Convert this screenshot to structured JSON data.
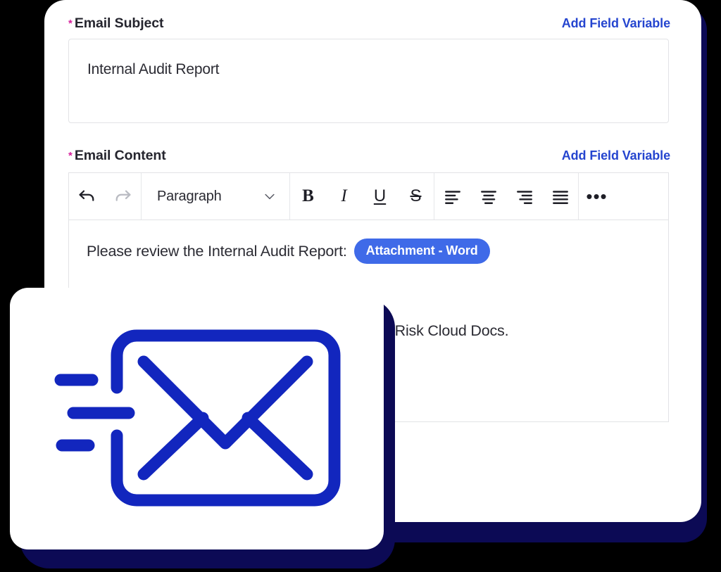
{
  "theme": {
    "accent_link": "#2545CF",
    "required_star": "#D6219C",
    "chip_bg": "#3F6AE8",
    "card_shadow_navy": "#0C0A55",
    "icon_blue": "#1226BE",
    "text_dark": "#2B2B33",
    "border_gray": "#E2E3E6",
    "disabled_gray": "#B9BBC2"
  },
  "subject_field": {
    "label": "Email Subject",
    "required_marker": "*",
    "add_variable_label": "Add Field Variable",
    "value": "Internal Audit Report",
    "placeholder": ""
  },
  "content_field": {
    "label": "Email Content",
    "required_marker": "*",
    "add_variable_label": "Add Field Variable"
  },
  "toolbar": {
    "undo": {
      "icon": "undo-arrow-icon",
      "glyph": "↶",
      "state": "enabled"
    },
    "redo": {
      "icon": "redo-arrow-icon",
      "glyph": "↷",
      "state": "disabled"
    },
    "block_format": {
      "selected": "Paragraph",
      "chevron_icon": "chevron-down-icon",
      "options": [
        "Paragraph"
      ]
    },
    "bold": {
      "label": "B",
      "name": "bold-button"
    },
    "italic": {
      "label": "I",
      "name": "italic-button"
    },
    "underline": {
      "label": "U",
      "name": "underline-button"
    },
    "strikethrough": {
      "label": "S",
      "name": "strikethrough-button"
    },
    "align_left": {
      "icon": "align-left-icon"
    },
    "align_center": {
      "icon": "align-center-icon"
    },
    "align_right": {
      "icon": "align-right-icon"
    },
    "align_justify": {
      "icon": "align-justify-icon"
    },
    "more": {
      "icon": "more-horizontal-icon",
      "glyph": "•••"
    }
  },
  "editor_content": {
    "line1_text": "Please review the Internal Audit Report:",
    "attachment_chip_label": "Attachment - Word",
    "line2_text": "via Risk Cloud Docs."
  },
  "overlay_card": {
    "icon_name": "sent-mail-envelope-icon",
    "icon_color": "#1226BE"
  }
}
